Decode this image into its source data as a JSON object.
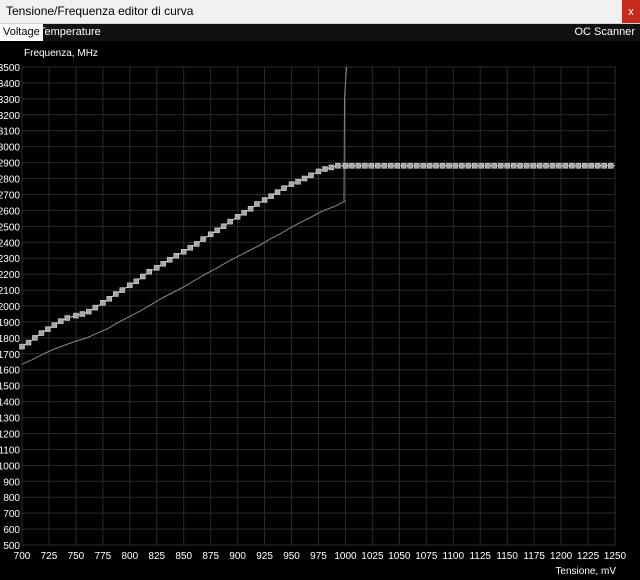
{
  "window": {
    "title": "Tensione/Frequenza editor di curva",
    "close_label": "x"
  },
  "tabs": [
    {
      "label": "Voltage",
      "active": true
    },
    {
      "label": "Temperature",
      "active": false
    }
  ],
  "oc_scanner_label": "OC Scanner",
  "colors": {
    "background": "#000000",
    "grid": "#2b2b2b",
    "curve": "#cfcfcf",
    "point": "#a8a8a8",
    "lower_curve": "#8a8a8a"
  },
  "chart_data": {
    "type": "line",
    "xlabel": "Tensione, mV",
    "ylabel": "Frequenza, MHz",
    "xlim": [
      700,
      1250
    ],
    "ylim": [
      500,
      3500
    ],
    "xticks": [
      700,
      725,
      750,
      775,
      800,
      825,
      850,
      875,
      900,
      925,
      950,
      975,
      1000,
      1025,
      1050,
      1075,
      1100,
      1125,
      1150,
      1175,
      1200,
      1225,
      1250
    ],
    "yticks": [
      500,
      600,
      700,
      800,
      900,
      1000,
      1100,
      1200,
      1300,
      1400,
      1500,
      1600,
      1700,
      1800,
      1900,
      2000,
      2100,
      2200,
      2300,
      2400,
      2500,
      2600,
      2700,
      2800,
      2900,
      3000,
      3100,
      3200,
      3300,
      3400,
      3500
    ],
    "grid": true,
    "series": [
      {
        "name": "",
        "x": [
          700,
          706,
          712,
          718,
          724,
          730,
          736,
          742,
          750,
          756,
          762,
          768,
          775,
          781,
          787,
          793,
          800,
          806,
          812,
          818,
          825,
          831,
          837,
          843,
          850,
          856,
          862,
          868,
          875,
          881,
          887,
          893,
          900,
          906,
          912,
          918,
          925,
          931,
          937,
          943,
          950,
          956,
          962,
          968,
          975,
          981,
          987,
          993,
          1000
        ],
        "y": [
          1745,
          1770,
          1800,
          1830,
          1855,
          1880,
          1905,
          1925,
          1940,
          1950,
          1965,
          1990,
          2020,
          2045,
          2075,
          2100,
          2130,
          2155,
          2185,
          2215,
          2240,
          2265,
          2290,
          2315,
          2340,
          2365,
          2390,
          2420,
          2450,
          2475,
          2500,
          2530,
          2560,
          2585,
          2610,
          2640,
          2665,
          2690,
          2715,
          2740,
          2765,
          2780,
          2800,
          2820,
          2845,
          2860,
          2870,
          2880,
          2880
        ]
      },
      {
        "name": "",
        "x": [
          1000,
          1006,
          1012,
          1018,
          1024,
          1030,
          1036,
          1042,
          1048,
          1054,
          1060,
          1066,
          1072,
          1078,
          1084,
          1090,
          1096,
          1102,
          1108,
          1114,
          1120,
          1126,
          1132,
          1138,
          1144,
          1150,
          1156,
          1162,
          1168,
          1174,
          1180,
          1186,
          1192,
          1198,
          1204,
          1210,
          1216,
          1222,
          1228,
          1234,
          1240,
          1246
        ],
        "y": [
          2880,
          2880,
          2880,
          2880,
          2880,
          2880,
          2880,
          2880,
          2880,
          2880,
          2880,
          2880,
          2880,
          2880,
          2880,
          2880,
          2880,
          2880,
          2880,
          2880,
          2880,
          2880,
          2880,
          2880,
          2880,
          2880,
          2880,
          2880,
          2880,
          2880,
          2880,
          2880,
          2880,
          2880,
          2880,
          2880,
          2880,
          2880,
          2880,
          2880,
          2880,
          2880
        ]
      },
      {
        "name": "",
        "x": [
          700,
          710,
          720,
          730,
          740,
          750,
          760,
          770,
          780,
          790,
          800,
          810,
          820,
          830,
          840,
          850,
          860,
          870,
          880,
          890,
          900,
          910,
          920,
          930,
          940,
          950,
          960,
          970,
          980,
          990,
          1000
        ],
        "y": [
          1635,
          1665,
          1700,
          1730,
          1755,
          1780,
          1800,
          1830,
          1860,
          1900,
          1935,
          1970,
          2010,
          2050,
          2085,
          2120,
          2160,
          2200,
          2235,
          2275,
          2310,
          2345,
          2380,
          2420,
          2455,
          2495,
          2530,
          2565,
          2600,
          2625,
          2660
        ]
      }
    ]
  }
}
